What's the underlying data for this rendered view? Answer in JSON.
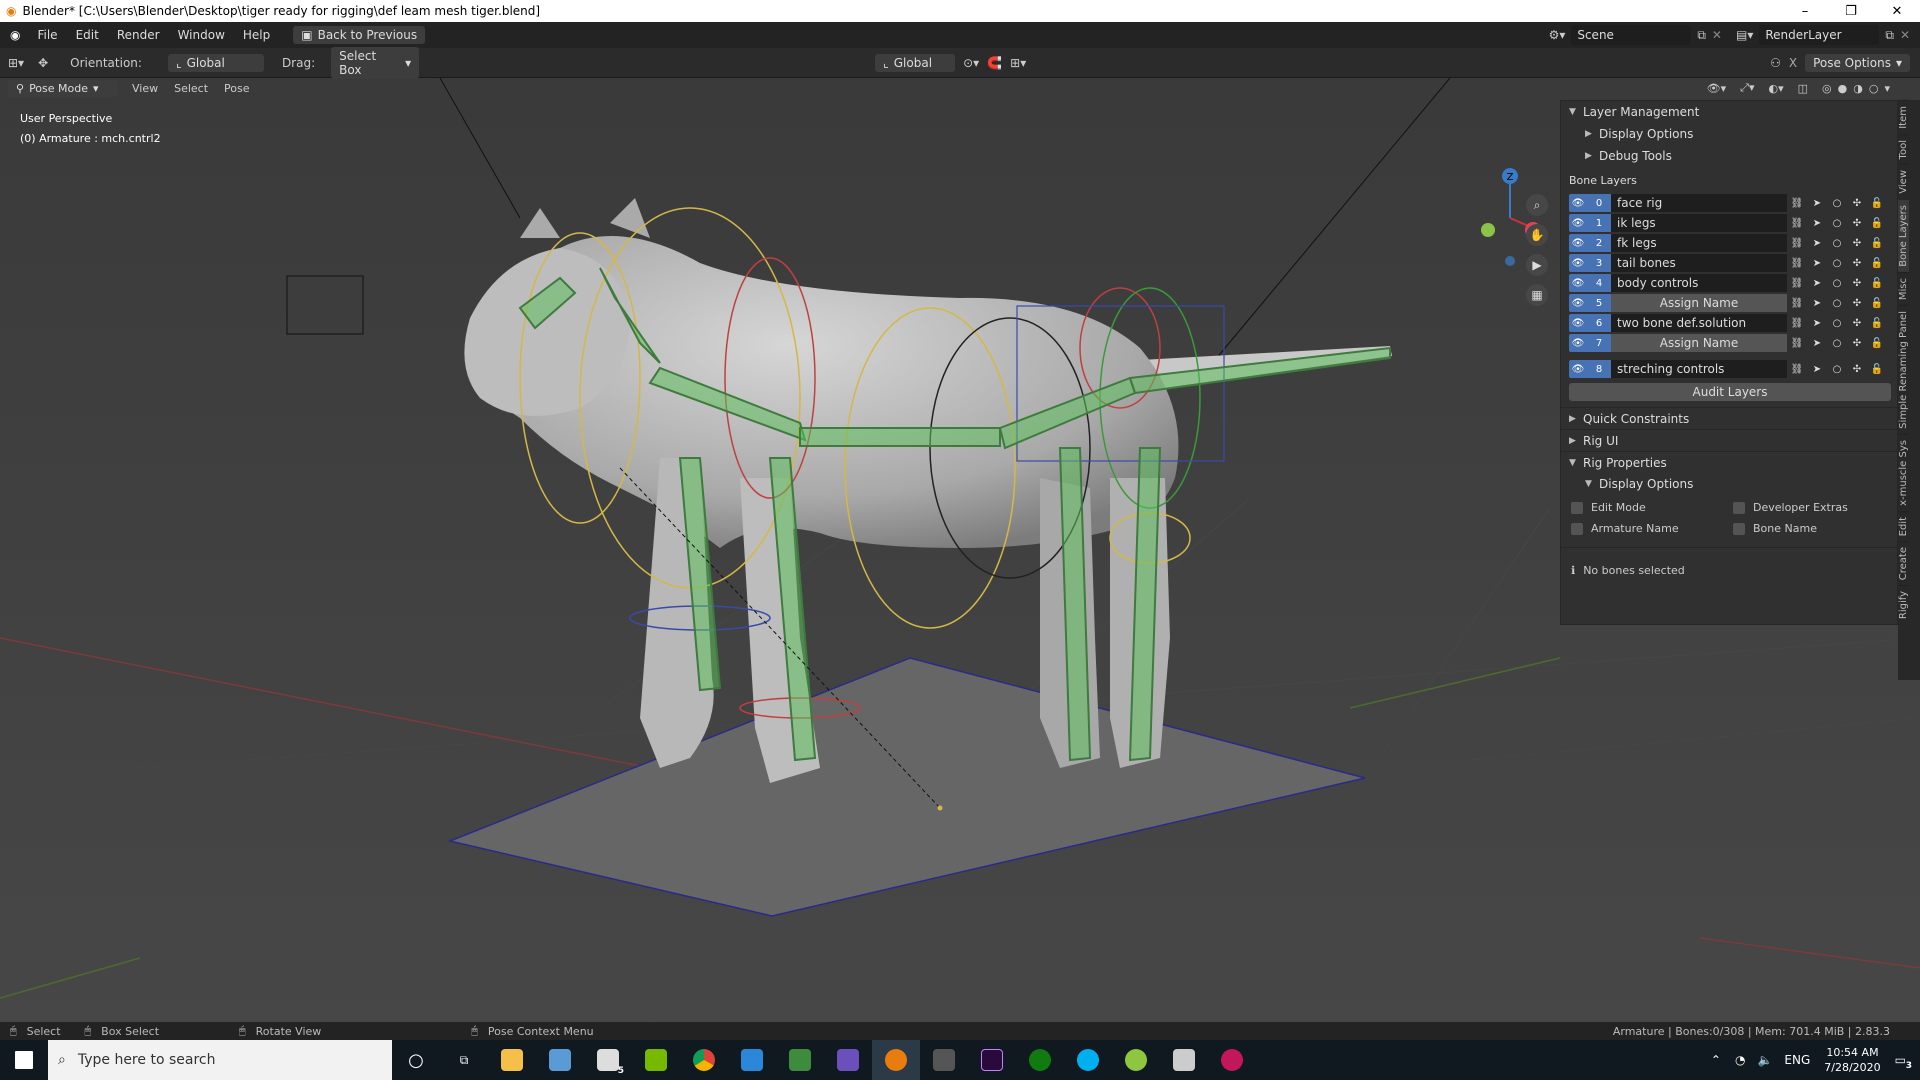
{
  "window": {
    "title": "Blender* [C:\\Users\\Blender\\Desktop\\tiger ready for rigging\\def leam mesh tiger.blend]",
    "minimize": "–",
    "maximize": "❐",
    "close": "✕"
  },
  "menu": {
    "items": [
      "File",
      "Edit",
      "Render",
      "Window",
      "Help"
    ],
    "back_button": "Back to Previous",
    "scene": "Scene",
    "render_layer": "RenderLayer"
  },
  "toolbar": {
    "orientation_label": "Orientation:",
    "orientation_value": "Global",
    "drag_label": "Drag:",
    "drag_value": "Select Box",
    "transform_orientation": "Global",
    "pose_options": "Pose Options"
  },
  "header2": {
    "mode": "Pose Mode",
    "view": "View",
    "select": "Select",
    "pose": "Pose"
  },
  "viewport": {
    "perspective": "User Perspective",
    "active_object": "(0) Armature : mch.cntrl2",
    "gizmo_x": "X",
    "gizmo_y": "Y",
    "gizmo_z": "Z"
  },
  "npanel": {
    "layer_management": "Layer Management",
    "display_options": "Display Options",
    "debug_tools": "Debug Tools",
    "bone_layers_label": "Bone Layers",
    "bone_layers": [
      {
        "num": "0",
        "name": "face rig",
        "assign": false
      },
      {
        "num": "1",
        "name": "ik legs",
        "assign": false
      },
      {
        "num": "2",
        "name": "fk legs",
        "assign": false
      },
      {
        "num": "3",
        "name": "tail bones",
        "assign": false
      },
      {
        "num": "4",
        "name": "body controls",
        "assign": false
      },
      {
        "num": "5",
        "name": "Assign Name",
        "assign": true
      },
      {
        "num": "6",
        "name": "two bone def.solution",
        "assign": false
      },
      {
        "num": "7",
        "name": "Assign Name",
        "assign": true
      }
    ],
    "layer8": {
      "num": "8",
      "name": "streching controls"
    },
    "audit_layers": "Audit Layers",
    "quick_constraints": "Quick Constraints",
    "rig_ui": "Rig UI",
    "rig_properties": "Rig Properties",
    "rig_display_options": "Display Options",
    "edit_mode": "Edit Mode",
    "developer_extras": "Developer Extras",
    "armature_name": "Armature Name",
    "bone_name": "Bone Name",
    "no_bones": "No bones selected"
  },
  "side_tabs": [
    "Item",
    "Tool",
    "View",
    "Bone Layers",
    "Misc",
    "Simple Renaming Panel",
    "x-muscle Sys",
    "Edit",
    "Create",
    "Rigify"
  ],
  "status": {
    "select": "Select",
    "box_select": "Box Select",
    "rotate_view": "Rotate View",
    "pose_context": "Pose Context Menu",
    "info": "Armature | Bones:0/308 | Mem: 701.4 MiB | 2.83.3"
  },
  "taskbar": {
    "search_placeholder": "Type here to search",
    "language": "ENG",
    "time": "10:54 AM",
    "date": "7/28/2020",
    "mail_badge": "5",
    "notification_badge": "3"
  },
  "colors": {
    "accent": "#4772b3",
    "bone_green": "#5fbf5f",
    "ring_yellow": "#d4b846",
    "ring_red": "#c04040",
    "ring_blue": "#3a4aa8"
  }
}
